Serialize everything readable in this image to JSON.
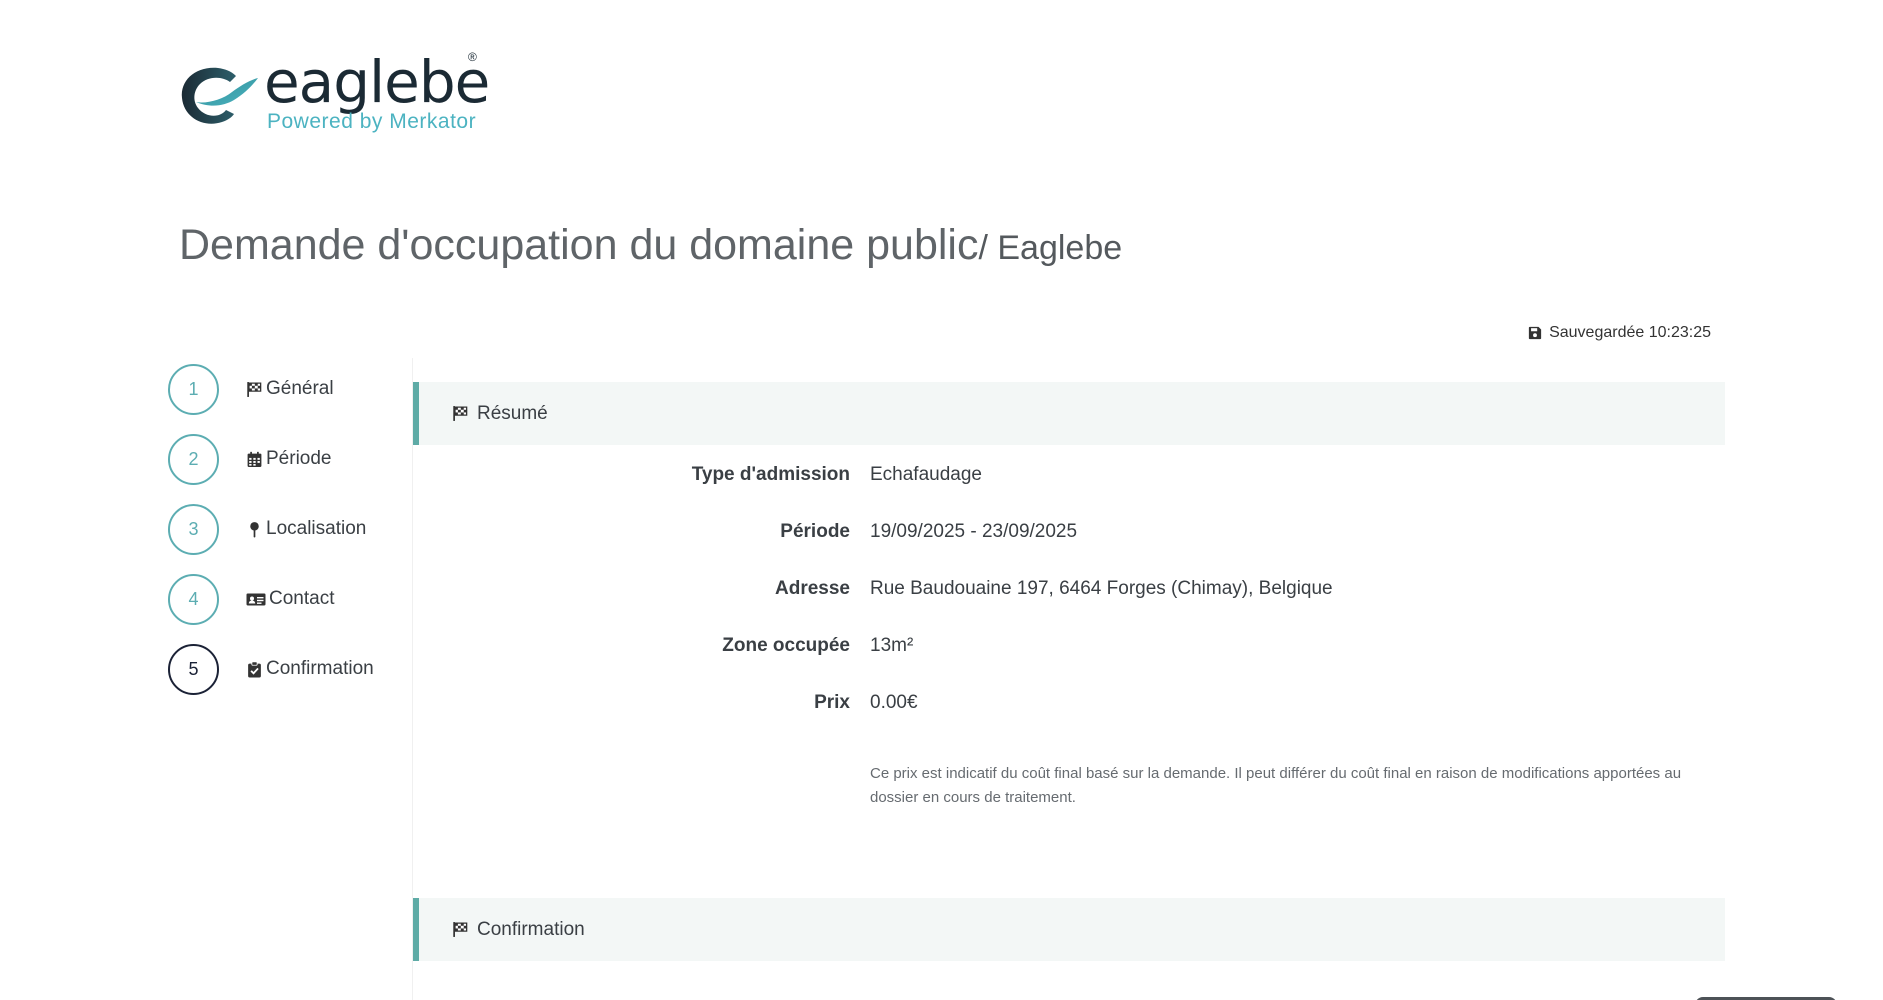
{
  "logo": {
    "wordmark": "eaglebe",
    "registered": "®",
    "tagline": "Powered by Merkator",
    "colors": {
      "dark": "#1b2a34",
      "accent": "#4cb3c1"
    }
  },
  "page": {
    "title": "Demande d'occupation du domaine public",
    "subtitle": "/ Eaglebe"
  },
  "save_status": {
    "icon": "floppy-disk-icon",
    "text": "Sauvegardée 10:23:25"
  },
  "steps": [
    {
      "number": "1",
      "label": "Général",
      "icon": "flag-checkered-icon"
    },
    {
      "number": "2",
      "label": "Période",
      "icon": "calendar-icon"
    },
    {
      "number": "3",
      "label": "Localisation",
      "icon": "map-pin-icon"
    },
    {
      "number": "4",
      "label": "Contact",
      "icon": "id-card-icon"
    },
    {
      "number": "5",
      "label": "Confirmation",
      "icon": "clipboard-check-icon",
      "active": true
    }
  ],
  "sections": {
    "resume": {
      "title": "Résumé",
      "icon": "flag-checkered-icon"
    },
    "confirmation": {
      "title": "Confirmation",
      "icon": "flag-checkered-icon"
    }
  },
  "summary": [
    {
      "label": "Type d'admission",
      "value": "Echafaudage"
    },
    {
      "label": "Période",
      "value": "19/09/2025 - 23/09/2025"
    },
    {
      "label": "Adresse",
      "value": "Rue Baudouaine 197, 6464 Forges (Chimay), Belgique"
    },
    {
      "label": "Zone occupée",
      "value": "13m²"
    },
    {
      "label": "Prix",
      "value": "0.00€"
    }
  ],
  "price_note": "Ce prix est indicatif du coût final basé sur la demande. Il peut différer du coût final en raison de modifications apportées au dossier en cours de traitement.",
  "colors": {
    "step_border": "#5cadb2",
    "step_active": "#1b2236",
    "section_bg": "#f3f7f6",
    "section_accent": "#5eaba6"
  }
}
